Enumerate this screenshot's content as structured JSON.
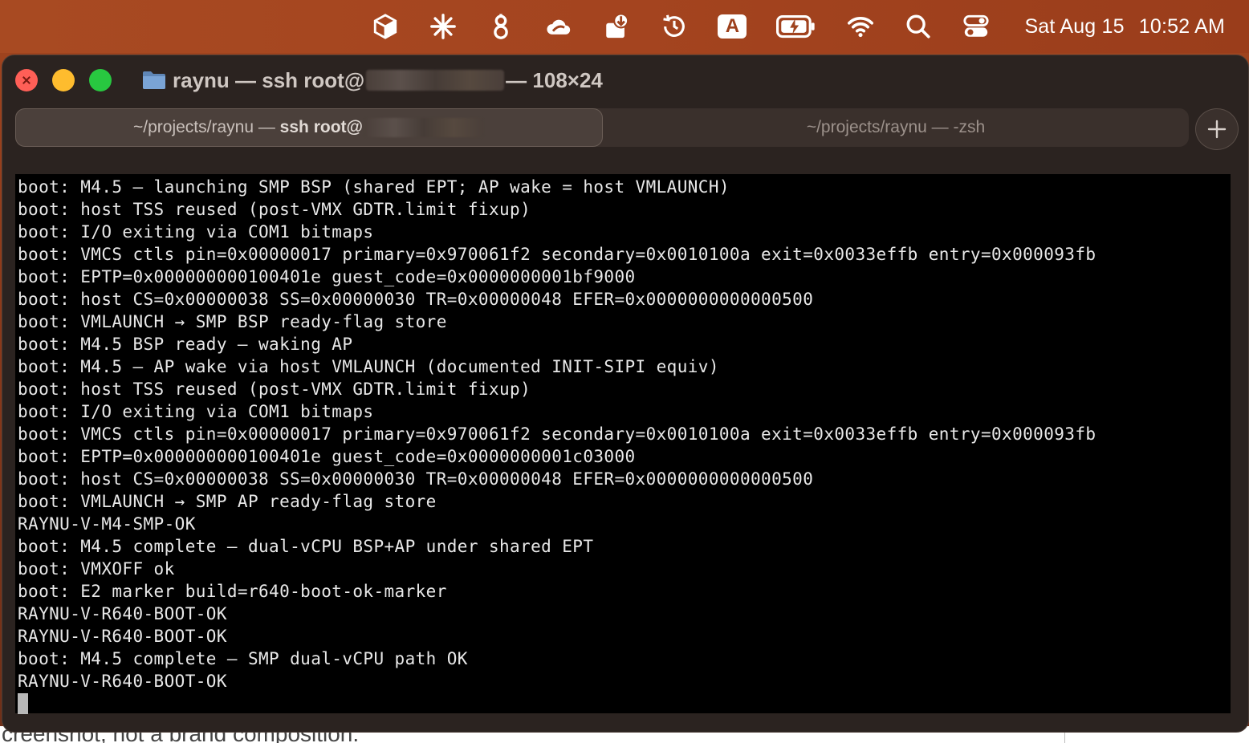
{
  "menubar": {
    "keyboard_badge": "A",
    "day": "Sat Aug 15",
    "time": "10:52 AM",
    "icons": [
      "package-icon",
      "sparkle-icon",
      "link-icon",
      "cloud-icon",
      "download-icon",
      "time-machine-icon",
      "keyboard-input-icon",
      "battery-charging-icon",
      "wifi-icon",
      "search-icon",
      "control-center-icon"
    ]
  },
  "window": {
    "title_prefix": "raynu — ssh root@",
    "title_suffix": "— 108×24",
    "tabs": [
      {
        "prefix": "~/projects/raynu — ",
        "strong": "ssh root@",
        "active": true
      },
      {
        "label": "~/projects/raynu — -zsh",
        "active": false
      }
    ]
  },
  "terminal": {
    "lines": [
      "boot: M4.5 — launching SMP BSP (shared EPT; AP wake = host VMLAUNCH)",
      "boot: host TSS reused (post-VMX GDTR.limit fixup)",
      "boot: I/O exiting via COM1 bitmaps",
      "boot: VMCS ctls pin=0x00000017 primary=0x970061f2 secondary=0x0010100a exit=0x0033effb entry=0x000093fb",
      "boot: EPTP=0x000000000100401e guest_code=0x0000000001bf9000",
      "boot: host CS=0x00000038 SS=0x00000030 TR=0x00000048 EFER=0x0000000000000500",
      "boot: VMLAUNCH → SMP BSP ready-flag store",
      "boot: M4.5 BSP ready — waking AP",
      "boot: M4.5 — AP wake via host VMLAUNCH (documented INIT-SIPI equiv)",
      "boot: host TSS reused (post-VMX GDTR.limit fixup)",
      "boot: I/O exiting via COM1 bitmaps",
      "boot: VMCS ctls pin=0x00000017 primary=0x970061f2 secondary=0x0010100a exit=0x0033effb entry=0x000093fb",
      "boot: EPTP=0x000000000100401e guest_code=0x0000000001c03000",
      "boot: host CS=0x00000038 SS=0x00000030 TR=0x00000048 EFER=0x0000000000000500",
      "boot: VMLAUNCH → SMP AP ready-flag store",
      "RAYNU-V-M4-SMP-OK",
      "boot: M4.5 complete — dual-vCPU BSP+AP under shared EPT",
      "boot: VMXOFF ok",
      "boot: E2 marker build=r640-boot-ok-marker",
      "RAYNU-V-R640-BOOT-OK",
      "RAYNU-V-R640-BOOT-OK",
      "boot: M4.5 complete — SMP dual-vCPU path OK",
      "RAYNU-V-R640-BOOT-OK"
    ]
  },
  "background": {
    "cut_text": "creenshot, not a brand composition."
  }
}
